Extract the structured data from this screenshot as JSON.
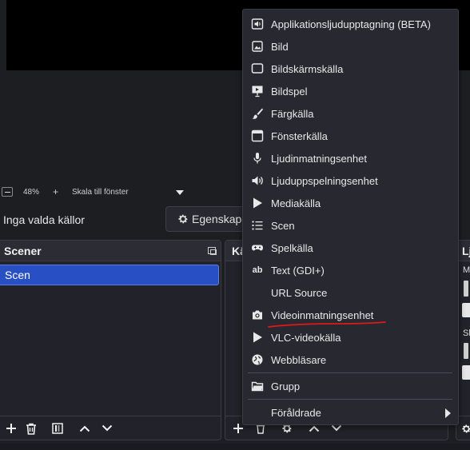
{
  "preview": {},
  "zoom_bar": {
    "zoom_level": "48%",
    "zoom_plus": "+",
    "scale_label": "Skala till fönster"
  },
  "sources_toolbar": {
    "no_sources_label": "Inga valda källor",
    "properties_label": "Egenskape"
  },
  "scenes_dock": {
    "title": "Scener",
    "scenes": [
      "Scen"
    ]
  },
  "sources_dock": {
    "title_partial": "Kä"
  },
  "mixer_dock": {
    "title_partial": "Lj",
    "channel_1_partial": "M",
    "channel_2_partial": "Sk"
  },
  "context_menu": {
    "items": [
      {
        "label": "Applikationsljudupptagning (BETA)",
        "icon": "app-audio-icon"
      },
      {
        "label": "Bild",
        "icon": "image-icon"
      },
      {
        "label": "Bildskärmskälla",
        "icon": "monitor-icon"
      },
      {
        "label": "Bildspel",
        "icon": "slideshow-icon"
      },
      {
        "label": "Färgkälla",
        "icon": "brush-icon"
      },
      {
        "label": "Fönsterkälla",
        "icon": "window-icon"
      },
      {
        "label": "Ljudinmatningsenhet",
        "icon": "microphone-icon"
      },
      {
        "label": "Ljuduppspelningsenhet",
        "icon": "speaker-icon"
      },
      {
        "label": "Mediakälla",
        "icon": "play-icon"
      },
      {
        "label": "Scen",
        "icon": "list-icon"
      },
      {
        "label": "Spelkälla",
        "icon": "gamepad-icon"
      },
      {
        "label": "Text (GDI+)",
        "icon": "text-icon"
      },
      {
        "label": "URL Source",
        "icon": ""
      },
      {
        "label": "Videoinmatningsenhet",
        "icon": "camera-icon"
      },
      {
        "label": "VLC-videokälla",
        "icon": "play-icon"
      },
      {
        "label": "Webbläsare",
        "icon": "globe-icon"
      }
    ],
    "group_label": "Grupp",
    "group_icon": "folder-icon",
    "deprecated_label": "Föråldrade"
  },
  "colors": {
    "background": "#1d1e22",
    "menu_background": "#272830",
    "selected_scene": "#2850c4",
    "annotation": "#e01818"
  }
}
